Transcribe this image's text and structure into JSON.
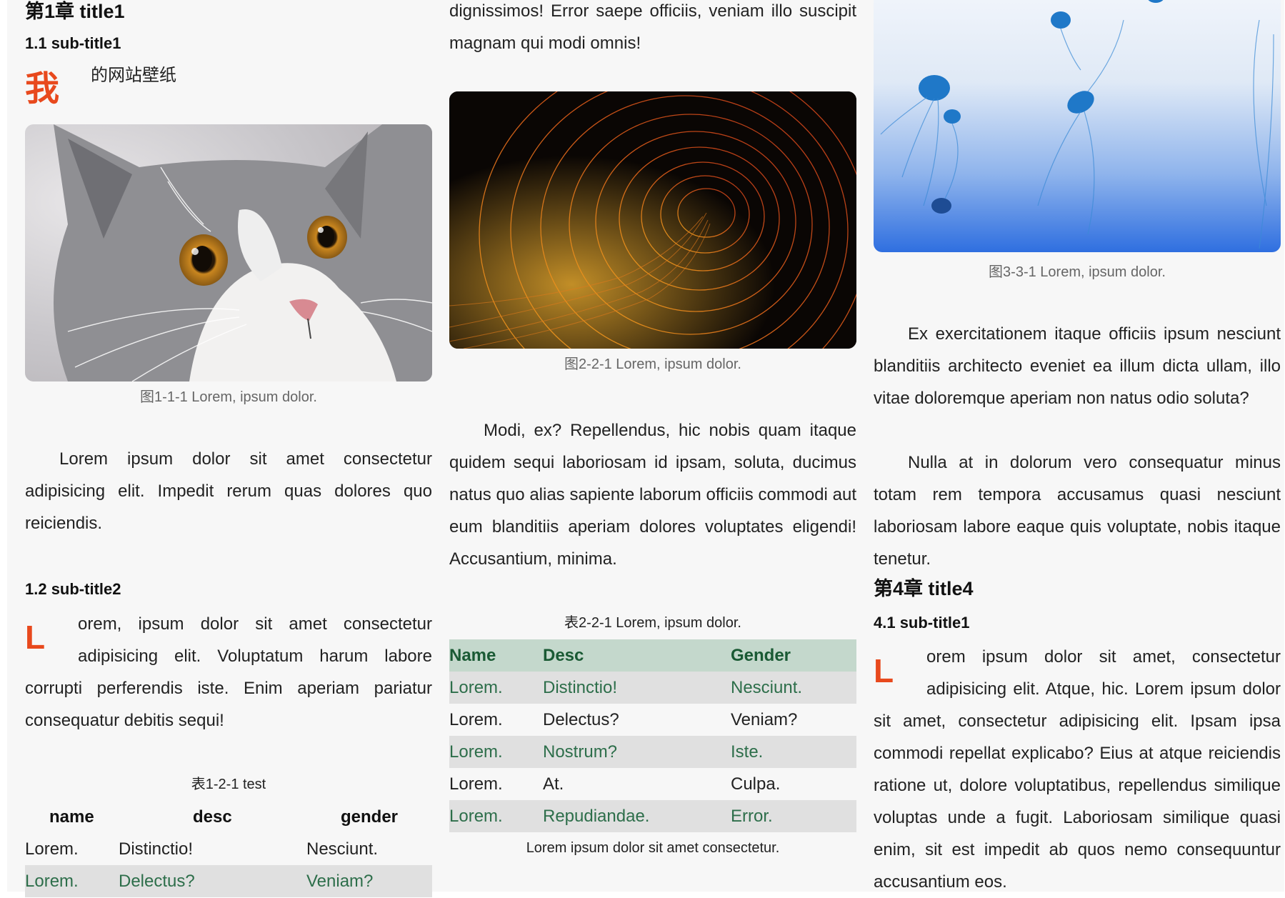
{
  "col1": {
    "chapter_title": "第1章 title1",
    "sub_title1": "1.1 sub-title1",
    "dropcap1": "我",
    "dropcap1_text": "的网站壁纸",
    "figure1_caption": "图1-1-1 Lorem, ipsum dolor.",
    "para1": "Lorem ipsum dolor sit amet consectetur adipisicing elit. Impedit rerum quas dolores quo reiciendis.",
    "sub_title2": "1.2 sub-title2",
    "dropcap2": "L",
    "para2_line1": "orem, ipsum dolor sit amet consectetur",
    "para2_line2": "adipisicing elit. Voluptatum harum labore",
    "para2_rest": "corrupti perferendis iste. Enim aperiam pariatur consequatur debitis sequi!",
    "table_caption": "表1-2-1 test",
    "table": {
      "headers": [
        "name",
        "desc",
        "gender"
      ],
      "rows": [
        [
          "Lorem.",
          "Distinctio!",
          "Nesciunt."
        ],
        [
          "Lorem.",
          "Delectus?",
          "Veniam?"
        ]
      ]
    }
  },
  "col2": {
    "para_top": "dignissimos! Error saepe officiis, veniam illo suscipit magnam qui modi omnis!",
    "figure_caption": "图2-2-1 Lorem, ipsum dolor.",
    "para": "Modi, ex? Repellendus, hic nobis quam itaque quidem sequi laboriosam id ipsam, soluta, ducimus natus quo alias sapiente laborum officiis commodi aut eum blanditiis aperiam dolores voluptates eligendi! Accusantium, minima.",
    "table_caption": "表2-2-1 Lorem, ipsum dolor.",
    "table": {
      "headers": [
        "Name",
        "Desc",
        "Gender"
      ],
      "rows": [
        [
          "Lorem.",
          "Distinctio!",
          "Nesciunt."
        ],
        [
          "Lorem.",
          "Delectus?",
          "Veniam?"
        ],
        [
          "Lorem.",
          "Nostrum?",
          "Iste."
        ],
        [
          "Lorem.",
          "At.",
          "Culpa."
        ],
        [
          "Lorem.",
          "Repudiandae.",
          "Error."
        ]
      ]
    },
    "table_footer": "Lorem ipsum dolor sit amet consectetur."
  },
  "col3": {
    "figure_caption": "图3-3-1 Lorem, ipsum dolor.",
    "para1": "Ex exercitationem itaque officiis ipsum nesciunt blanditiis architecto eveniet ea illum dicta ullam, illo vitae doloremque aperiam non natus odio soluta?",
    "para2": "Nulla at in dolorum vero consequatur minus totam rem tempora accusamus quasi nesciunt laboriosam labore eaque quis voluptate, nobis itaque tenetur.",
    "chapter_title": "第4章 title4",
    "sub_title1": "4.1 sub-title1",
    "dropcap": "L",
    "para3_line1": "orem ipsum dolor sit amet, consectetur",
    "para3_line2": "adipisicing elit. Atque, hic. Lorem ipsum dolor",
    "para3_rest": "sit amet, consectetur adipisicing elit. Ipsam ipsa commodi repellat explicabo? Eius at atque reiciendis ratione ut, dolore voluptatibus, repellendus similique voluptas unde a fugit. Laboriosam similique quasi enim, sit est impedit ab quos nemo consequuntur accusantium eos."
  },
  "colors": {
    "accent": "#e8491d",
    "table_header_bg": "#c4d8cc",
    "table_header_text": "#1a5a34",
    "shaded_row_bg": "#e0e0e0",
    "shaded_row_text": "#2d6e4a"
  }
}
